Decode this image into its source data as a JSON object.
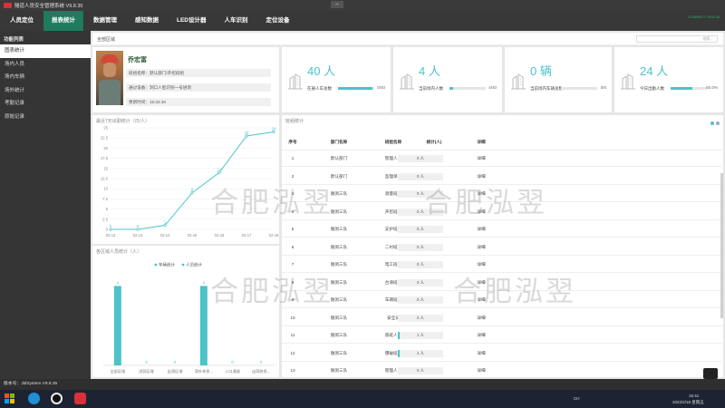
{
  "window": {
    "title": "隧道人员安全管理系统 V9.8.35"
  },
  "nav": {
    "tabs": [
      "人员定位",
      "报表统计",
      "数据管理",
      "感知数据",
      "LED设计器",
      "人车识别",
      "定位设备"
    ],
    "active": 1,
    "status": "CONNECT V9.8.35"
  },
  "sidebar": {
    "header": "功能列表",
    "items": [
      "图表统计",
      "场内人员",
      "场内车辆",
      "场外统计",
      "考勤记录",
      "原始记录"
    ],
    "active": 0
  },
  "breadcrumb": {
    "label": "全部区域",
    "search_placeholder": "搜索..."
  },
  "person": {
    "name": "乔宏富",
    "team": "班组名称：默认部门/开挖班组",
    "device": "通过设备：洞口人脸识别一号进洞",
    "time": "更新时间：15:33:18"
  },
  "stats": [
    {
      "num": "40 人",
      "label": "在册人车总数",
      "ratio": "0/40",
      "fill": 0.95,
      "icon": "building-icon"
    },
    {
      "num": "4 人",
      "label": "当前场内人数",
      "ratio": "4/40",
      "fill": 0.1,
      "icon": "building-icon"
    },
    {
      "num": "0 辆",
      "label": "当前场内车辆总数",
      "ratio": "0/0",
      "fill": 0.0,
      "icon": "building-icon"
    },
    {
      "num": "24 人",
      "label": "今日出勤人数",
      "ratio": "60.0%",
      "fill": 0.6,
      "icon": "building-icon"
    }
  ],
  "line_chart": {
    "title": "最近7天出勤统计（日/人）",
    "chart_data": {
      "type": "line",
      "categories": [
        "02-12",
        "02-13",
        "02-14",
        "02-15",
        "02-16",
        "02-17",
        "02-18"
      ],
      "values": [
        0,
        0,
        1,
        9,
        14,
        23,
        24
      ],
      "ylim": [
        0,
        25
      ],
      "yticks": [
        0,
        2.5,
        5,
        7.5,
        10,
        12.5,
        15,
        17.5,
        20,
        22.5,
        25
      ],
      "grid": true
    }
  },
  "bar_chart": {
    "title": "各区域人员统计（人）",
    "chart_data": {
      "type": "bar",
      "categories": [
        "全部区域",
        "进洞区域",
        "出洞区域",
        "洞外休息...",
        "入口通道",
        "出洞休息..."
      ],
      "series": [
        {
          "name": "车辆统计",
          "values": [
            0,
            0,
            0,
            0,
            0,
            0
          ],
          "color": "#4cc3c8"
        },
        {
          "name": "人员统计",
          "values": [
            4,
            0,
            0,
            4,
            0,
            0
          ],
          "color": "#4cc3c8"
        }
      ],
      "data_labels": [
        4,
        0,
        0,
        4,
        0,
        0
      ]
    }
  },
  "table": {
    "title": "班组统计",
    "headers": [
      "序号",
      "部门名称",
      "班组名称",
      "统计(人)",
      "详细"
    ],
    "rows": [
      [
        "1",
        "默认部门",
        "管理人员",
        "0 人",
        "详细"
      ],
      [
        "2",
        "默认部门",
        "监理单位",
        "0 人",
        "详细"
      ],
      [
        "3",
        "隧洞三队",
        "测量班组",
        "0 人",
        "详细"
      ],
      [
        "4",
        "隧洞三队",
        "开挖班组",
        "0 人",
        "详细"
      ],
      [
        "5",
        "隧洞三队",
        "支护班组",
        "0 人",
        "详细"
      ],
      [
        "6",
        "隧洞三队",
        "二衬班组",
        "0 人",
        "详细"
      ],
      [
        "7",
        "隧洞三队",
        "电工班组",
        "0 人",
        "详细"
      ],
      [
        "8",
        "隧洞三队",
        "台滑班组",
        "0 人",
        "详细"
      ],
      [
        "9",
        "隧洞三队",
        "车辆班组",
        "0 人",
        "详细"
      ],
      [
        "10",
        "隧洞三队",
        "安全员",
        "0 人",
        "详细"
      ],
      [
        "11",
        "隧洞三队",
        "值班人员",
        "1 人",
        "详细"
      ],
      [
        "12",
        "隧洞三队",
        "爆破班组",
        "1 人",
        "详细"
      ],
      [
        "13",
        "隧洞三队",
        "管理人员",
        "0 人",
        "详细"
      ],
      [
        "14",
        "默认部门",
        "安全员",
        "0 人",
        "详细"
      ]
    ]
  },
  "watermarks": [
    "合肥泓翌",
    "合肥泓翌",
    "合肥泓翌",
    "合肥泓翌"
  ],
  "footer": {
    "version": "版本号：JldSystem V9.8.35"
  },
  "taskbar": {
    "clock_time": "15:41",
    "clock_date": "2022/2/18 星期五",
    "lang": "CH"
  }
}
